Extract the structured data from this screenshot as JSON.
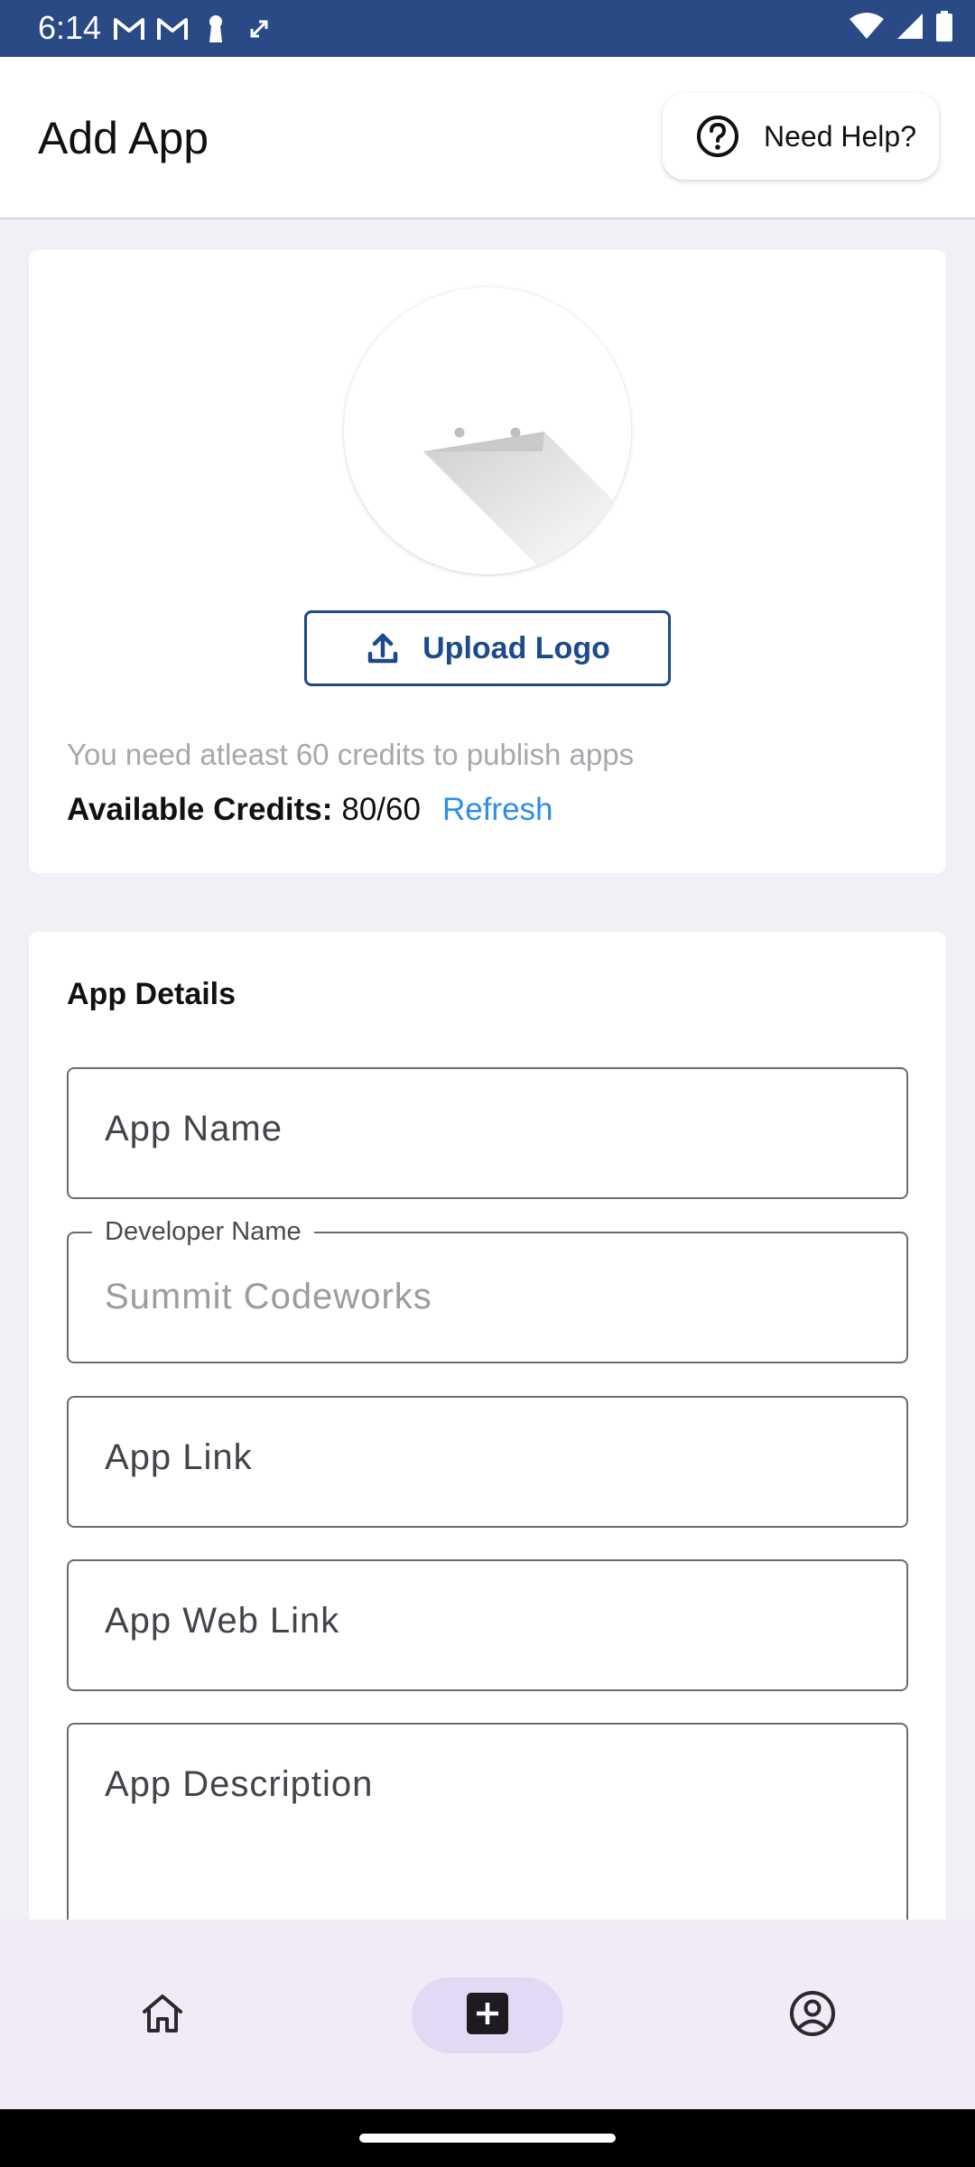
{
  "status_bar": {
    "time": "6:14",
    "left_icons": [
      "gmail-icon",
      "gmail-icon",
      "keyhole-icon",
      "sync-icon"
    ],
    "right_icons": [
      "wifi-icon",
      "signal-icon",
      "battery-icon"
    ]
  },
  "header": {
    "title": "Add App",
    "help_button_label": "Need Help?",
    "help_icon": "help-circle-icon"
  },
  "logo_section": {
    "placeholder_icon": "app-logo-placeholder-icon",
    "upload_button_label": "Upload Logo",
    "upload_icon": "upload-icon",
    "credits_note": "You need atleast 60 credits to publish apps",
    "credits_label": "Available Credits:",
    "credits_value": "80/60",
    "refresh_label": "Refresh"
  },
  "app_details": {
    "title": "App Details",
    "fields": {
      "app_name": {
        "placeholder": "App Name"
      },
      "developer_name": {
        "label": "Developer Name",
        "value": "Summit Codeworks"
      },
      "app_link": {
        "placeholder": "App Link"
      },
      "app_web_link": {
        "placeholder": "App Web Link"
      },
      "app_description": {
        "placeholder": "App Description"
      }
    }
  },
  "bottom_nav": {
    "items": [
      {
        "icon": "home-icon",
        "selected": false
      },
      {
        "icon": "add-box-icon",
        "selected": true
      },
      {
        "icon": "account-circle-icon",
        "selected": false
      }
    ]
  },
  "colors": {
    "status_bar": "#2a4a85",
    "primary": "#1c4a8a",
    "link": "#2d8ee8",
    "page_background": "#eff1f6",
    "nav_background": "#f2eaf6",
    "nav_selected": "#e3d9f4"
  }
}
